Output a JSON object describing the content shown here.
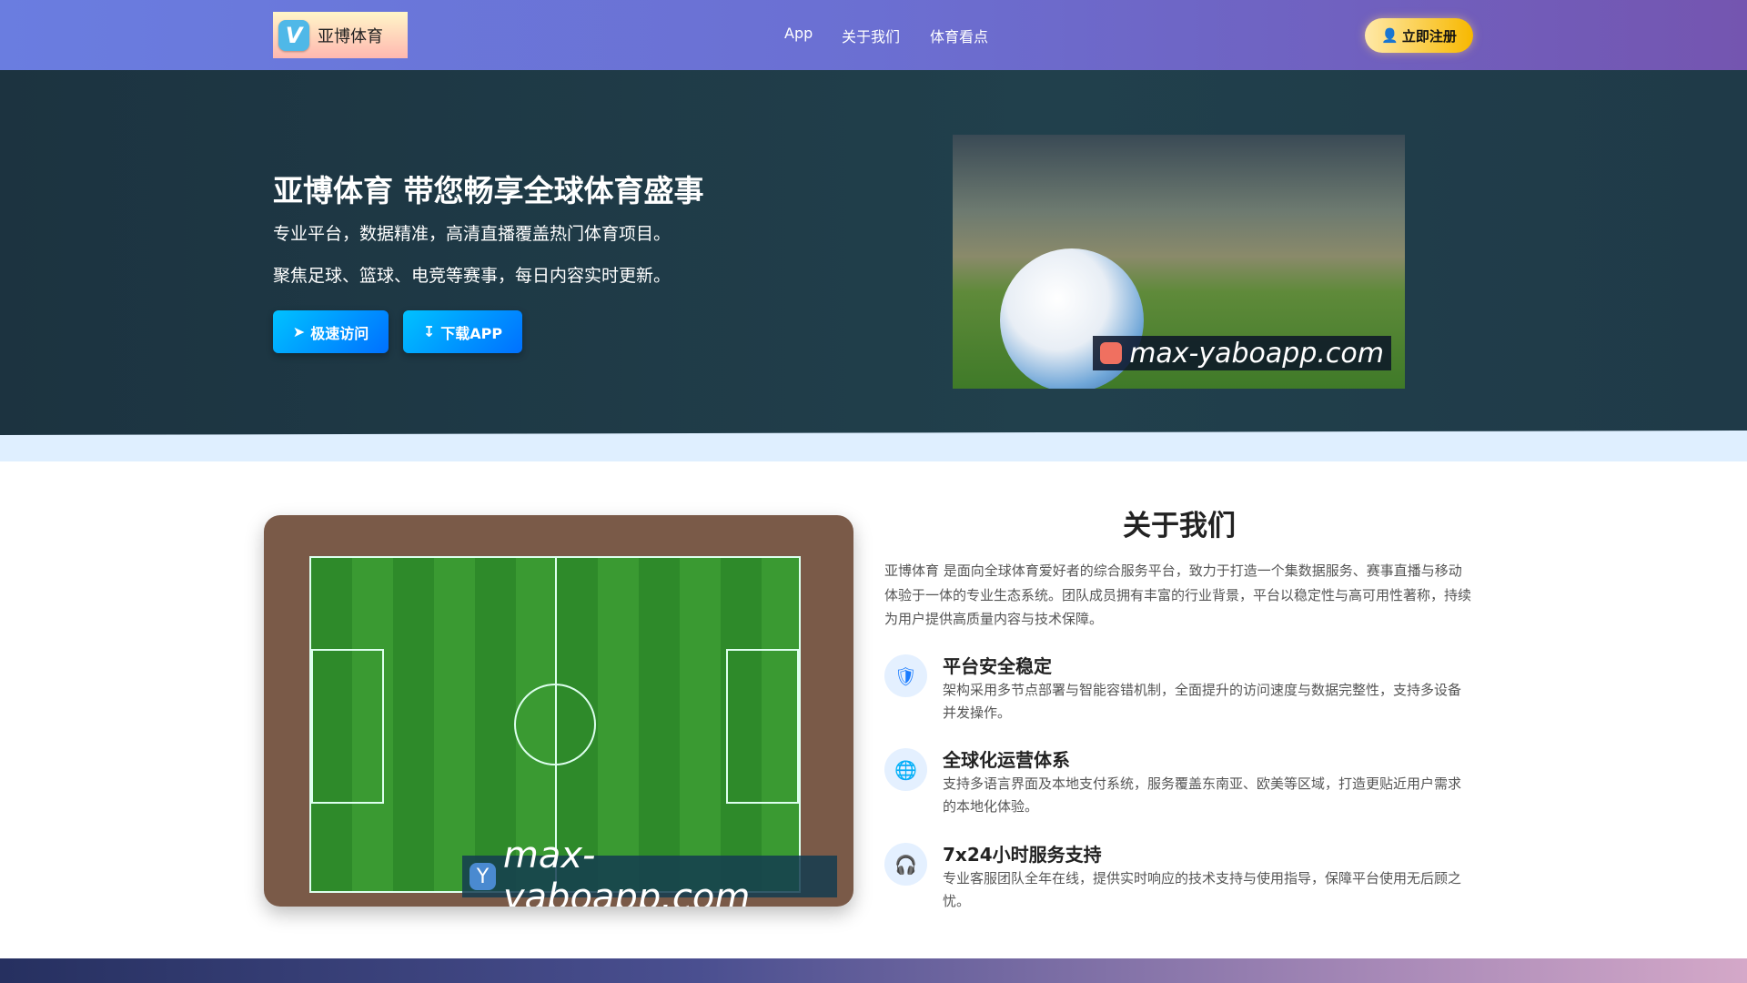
{
  "nav": {
    "logo_text": "亚博体育",
    "logo_letter": "V",
    "links": [
      "App",
      "关于我们",
      "体育看点"
    ],
    "register": "立即注册"
  },
  "hero": {
    "title": "亚博体育 带您畅享全球体育盛事",
    "line1": "专业平台，数据精准，高清直播覆盖热门体育项目。",
    "line2": "聚焦足球、篮球、电竞等赛事，每日内容实时更新。",
    "btn_visit": "极速访问",
    "btn_download": "下载APP",
    "watermark": "max-yaboapp.com"
  },
  "about": {
    "title": "关于我们",
    "paragraph": "亚博体育 是面向全球体育爱好者的综合服务平台，致力于打造一个集数据服务、赛事直播与移动体验于一体的专业生态系统。团队成员拥有丰富的行业背景，平台以稳定性与高可用性著称，持续为用户提供高质量内容与技术保障。",
    "watermark": "max-yaboapp.com",
    "watermark_letter": "Y",
    "features": [
      {
        "icon": "shield-icon",
        "title": "平台安全稳定",
        "desc": "架构采用多节点部署与智能容错机制，全面提升的访问速度与数据完整性，支持多设备并发操作。"
      },
      {
        "icon": "globe-icon",
        "title": "全球化运营体系",
        "desc": "支持多语言界面及本地支付系统，服务覆盖东南亚、欧美等区域，打造更贴近用户需求的本地化体验。"
      },
      {
        "icon": "headset-icon",
        "title": "7x24小时服务支持",
        "desc": "专业客服团队全年在线，提供实时响应的技术支持与使用指导，保障平台使用无后顾之忧。"
      }
    ]
  }
}
